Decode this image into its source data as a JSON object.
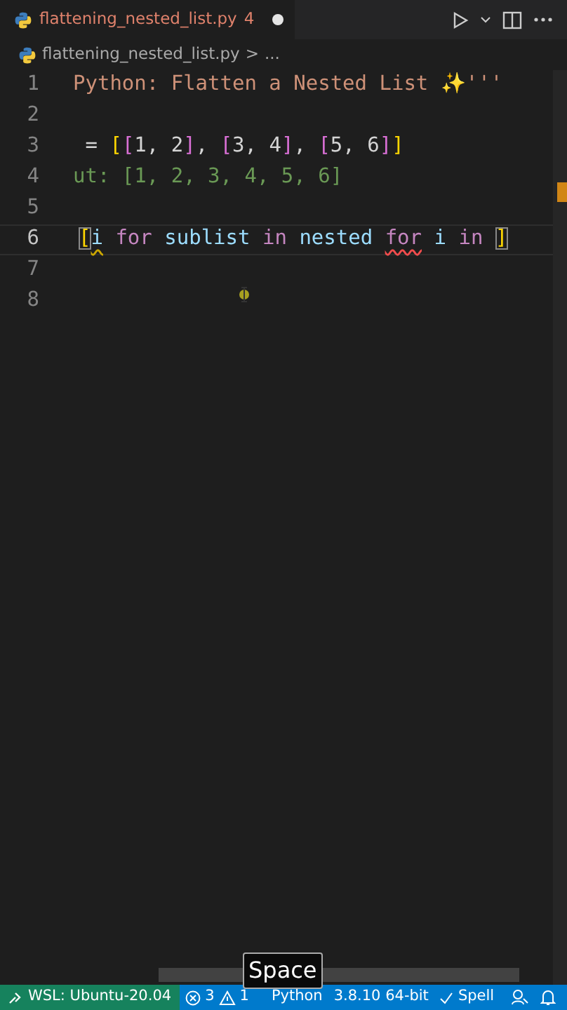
{
  "tab": {
    "filename": "flattening_nested_list.py",
    "problem_count": "4",
    "unsaved": true
  },
  "breadcrumb": {
    "file": "flattening_nested_list.py",
    "separator": ">",
    "more": "..."
  },
  "code_lines": [
    {
      "number": "1",
      "current": false,
      "tokens": [
        {
          "text": "Python: Flatten a Nested List ✨'''",
          "kind": "string"
        }
      ]
    },
    {
      "number": "2",
      "current": false
    },
    {
      "number": "3",
      "current": false,
      "tokens": [
        {
          "text": " = ",
          "kind": "plain"
        },
        {
          "text": "[",
          "kind": "bracket1"
        },
        {
          "text": "[",
          "kind": "bracket2"
        },
        {
          "text": "1",
          "kind": "plain"
        },
        {
          "text": ", ",
          "kind": "plain"
        },
        {
          "text": "2",
          "kind": "plain"
        },
        {
          "text": "]",
          "kind": "bracket2"
        },
        {
          "text": ", ",
          "kind": "plain"
        },
        {
          "text": "[",
          "kind": "bracket2"
        },
        {
          "text": "3",
          "kind": "plain"
        },
        {
          "text": ", ",
          "kind": "plain"
        },
        {
          "text": "4",
          "kind": "plain"
        },
        {
          "text": "]",
          "kind": "bracket2"
        },
        {
          "text": ", ",
          "kind": "plain"
        },
        {
          "text": "[",
          "kind": "bracket2"
        },
        {
          "text": "5",
          "kind": "plain"
        },
        {
          "text": ", ",
          "kind": "plain"
        },
        {
          "text": "6",
          "kind": "plain"
        },
        {
          "text": "]",
          "kind": "bracket2"
        },
        {
          "text": "]",
          "kind": "bracket1"
        }
      ]
    },
    {
      "number": "4",
      "current": false,
      "tokens": [
        {
          "text": "ut: [1, 2, 3, 4, 5, 6]",
          "kind": "comment"
        }
      ]
    },
    {
      "number": "5",
      "current": false
    },
    {
      "number": "6",
      "current": true,
      "tokens": [
        {
          "text": "[",
          "kind": "bracket1",
          "matched": true
        },
        {
          "text": "i",
          "kind": "variable",
          "warning": true
        },
        {
          "text": " for",
          "kind": "keyword"
        },
        {
          "text": " sublist",
          "kind": "variable"
        },
        {
          "text": " in",
          "kind": "keyword"
        },
        {
          "text": " nested",
          "kind": "variable"
        },
        {
          "text": " for",
          "kind": "keyword",
          "error": true
        },
        {
          "text": " i",
          "kind": "variable"
        },
        {
          "text": " in",
          "kind": "keyword"
        },
        {
          "text": " ]",
          "kind": "bracket1",
          "matched": true
        }
      ]
    },
    {
      "number": "7",
      "current": false
    },
    {
      "number": "8",
      "current": false
    }
  ],
  "key_overlay": "Space",
  "status_bar": {
    "remote": "WSL: Ubuntu-20.04",
    "errors": "3",
    "warnings": "1",
    "language": "Python",
    "interpreter": "3.8.10 64-bit",
    "spell": "Spell"
  }
}
